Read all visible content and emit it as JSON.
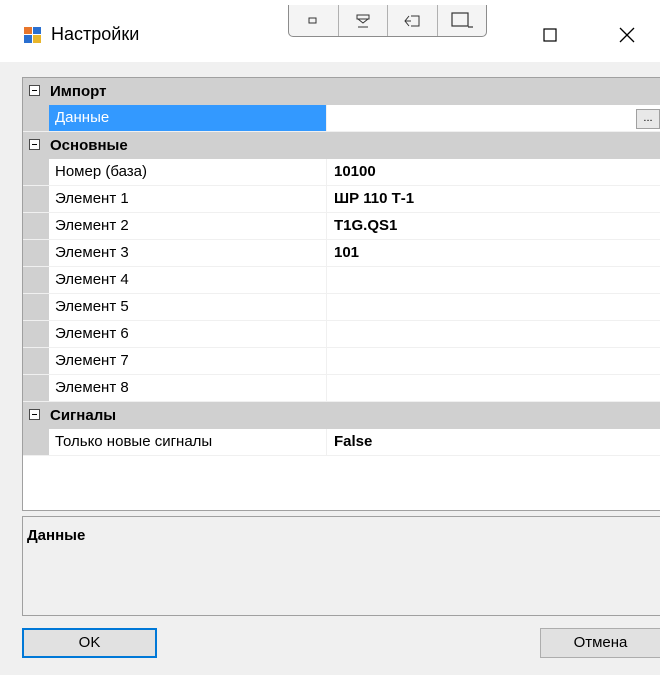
{
  "window": {
    "title": "Настройки",
    "icon": "app-window-icon",
    "snap_icons": [
      "snap-small-icon",
      "snap-collapse-icon",
      "snap-restore-icon",
      "snap-window-icon"
    ],
    "controls": [
      "maximize-icon",
      "close-icon"
    ]
  },
  "grid": {
    "categories": [
      {
        "label": "Импорт",
        "expanded": true,
        "properties": [
          {
            "name": "Данные",
            "value": "",
            "selected": true,
            "has_button": true,
            "button_label": "..."
          }
        ]
      },
      {
        "label": "Основные",
        "expanded": true,
        "properties": [
          {
            "name": "Номер (база)",
            "value": "10100"
          },
          {
            "name": "Элемент 1",
            "value": "ШР 110 Т-1"
          },
          {
            "name": "Элемент 2",
            "value": "T1G.QS1"
          },
          {
            "name": "Элемент 3",
            "value": "101"
          },
          {
            "name": "Элемент 4",
            "value": ""
          },
          {
            "name": "Элемент 5",
            "value": ""
          },
          {
            "name": "Элемент 6",
            "value": ""
          },
          {
            "name": "Элемент 7",
            "value": ""
          },
          {
            "name": "Элемент 8",
            "value": ""
          }
        ]
      },
      {
        "label": "Сигналы",
        "expanded": true,
        "properties": [
          {
            "name": "Только новые сигналы",
            "value": "False"
          }
        ]
      }
    ]
  },
  "help": {
    "title": "Данные"
  },
  "buttons": {
    "ok": "OK",
    "cancel": "Отмена"
  },
  "colors": {
    "selection": "#3399ff",
    "category": "#d0d0d0",
    "focus_border": "#0078d7"
  }
}
